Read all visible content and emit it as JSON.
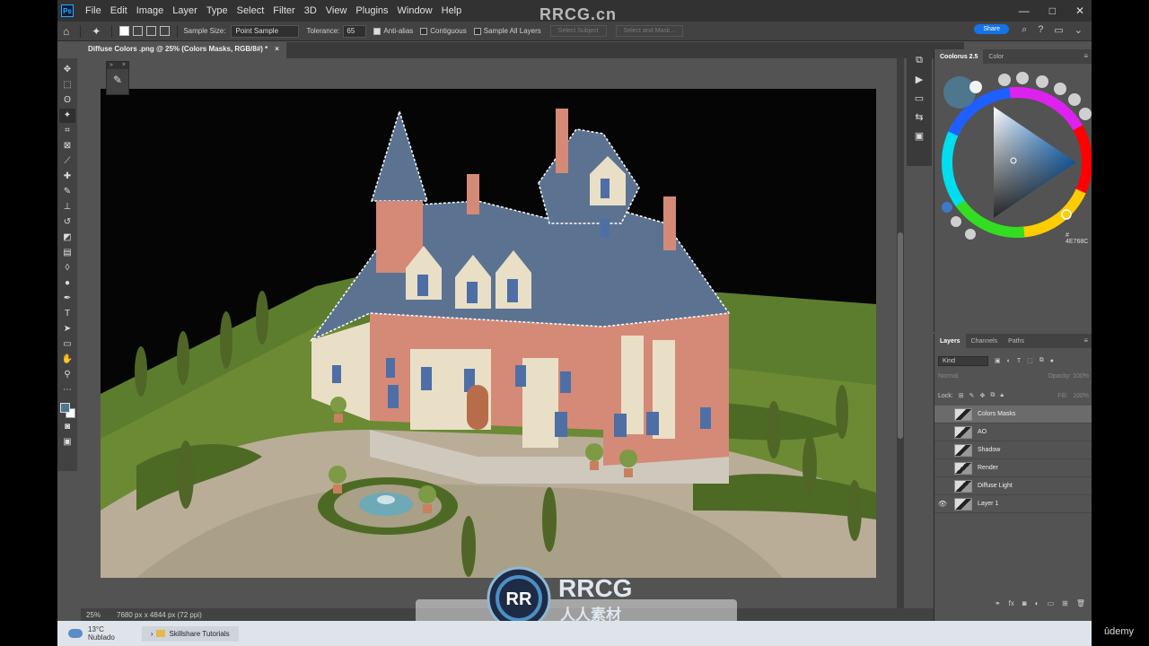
{
  "menubar": {
    "logo": "Ps",
    "items": [
      "File",
      "Edit",
      "Image",
      "Layer",
      "Type",
      "Select",
      "Filter",
      "3D",
      "View",
      "Plugins",
      "Window",
      "Help"
    ],
    "watermark": "RRCG.cn",
    "window_controls": [
      "—",
      "□",
      "✕"
    ]
  },
  "options": {
    "sample_size_label": "Sample Size:",
    "sample_size_value": "Point Sample",
    "tolerance_label": "Tolerance:",
    "tolerance_value": "65",
    "antialias": "Anti-alias",
    "contiguous": "Contiguous",
    "sample_all_layers": "Sample All Layers",
    "select_subject": "Select Subject",
    "select_and_mask": "Select and Mask...",
    "share": "Share"
  },
  "document": {
    "tab_title": "Diffuse Colors .png @ 25% (Colors Masks, RGB/8#) *",
    "close": "×"
  },
  "status": {
    "zoom": "25%",
    "dimensions": "7680 px x 4844 px (72 ppi)"
  },
  "colour_panel": {
    "tabs": [
      "Coolorus 2.5",
      "Color"
    ],
    "hex": "# 4E768C",
    "accent": "#4E768C"
  },
  "layers_panel": {
    "tabs": [
      "Layers",
      "Channels",
      "Paths"
    ],
    "kind_label": "Kind",
    "blend_mode": "Normal",
    "opacity_label": "Opacity:",
    "opacity_value": "100%",
    "lock_label": "Lock:",
    "fill_label": "Fill:",
    "fill_value": "100%",
    "layers": [
      {
        "name": "Colors Masks",
        "visible": false,
        "selected": true
      },
      {
        "name": "AO",
        "visible": false,
        "selected": false
      },
      {
        "name": "Shadow",
        "visible": false,
        "selected": false
      },
      {
        "name": "Render",
        "visible": false,
        "selected": false
      },
      {
        "name": "Diffuse Light",
        "visible": false,
        "selected": false
      },
      {
        "name": "Layer 1",
        "visible": true,
        "selected": false
      }
    ],
    "footer_icons": [
      "link-icon",
      "fx-icon",
      "mask-icon",
      "adjustment-icon",
      "folder-icon",
      "new-layer-icon",
      "trash-icon"
    ]
  },
  "taskbar": {
    "temperature": "13°C",
    "weather": "Nublado",
    "item": "Skillshare Tutorials"
  },
  "brand": {
    "udemy": "ûdemy",
    "rrcg": "RRCG"
  }
}
